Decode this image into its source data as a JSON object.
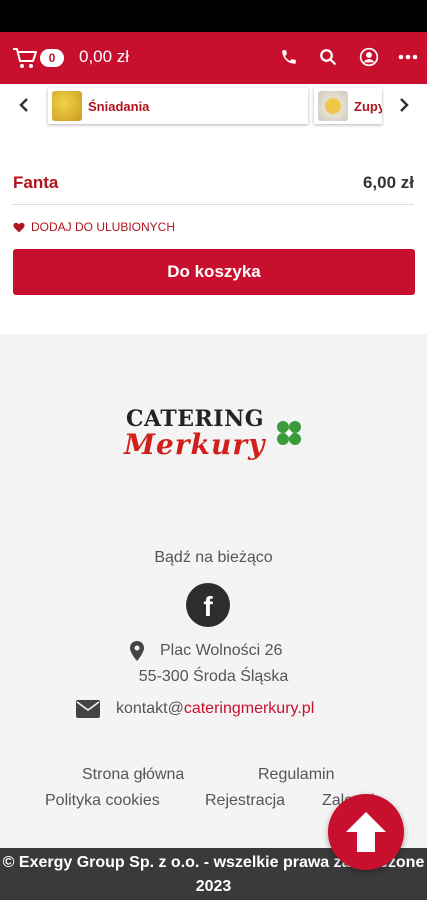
{
  "header": {
    "cart_count": "0",
    "cart_total": "0,00 zł",
    "icons": [
      "cart-icon",
      "phone-icon",
      "search-icon",
      "user-icon",
      "more-icon"
    ],
    "accent": "#c8102e"
  },
  "categories": [
    {
      "label": "Śniadania",
      "thumb": "breakfast"
    },
    {
      "label": "Zupy",
      "thumb": "soup"
    }
  ],
  "product": {
    "name": "Fanta",
    "price": "6,00 zł",
    "favorite_label": "DODAJ DO ULUBIONYCH",
    "add_to_cart_label": "Do koszyka"
  },
  "footer": {
    "logo_top": "CATERING",
    "logo_bottom": "Merkury",
    "stay_tuned": "Bądź na bieżąco",
    "facebook_glyph": "f",
    "address_line1": "Plac Wolności 26",
    "address_line2": "55-300 Środa Śląska",
    "email_prefix": "kontakt@",
    "email_domain": "cateringmerkury.pl",
    "links": [
      "Strona główna",
      "Regulamin",
      "Polityka cookies",
      "Rejestracja",
      "Zaloguj"
    ],
    "copyright": "© Exergy Group Sp. z o.o. - wszelkie prawa zastrzeżone 2023"
  }
}
